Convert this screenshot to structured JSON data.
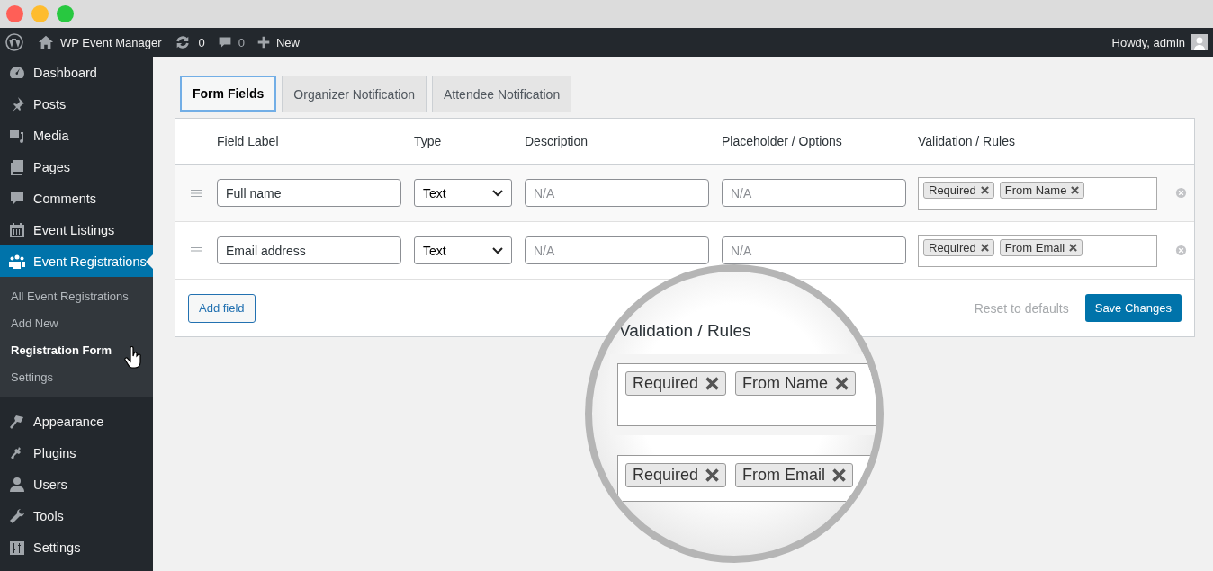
{
  "window": {
    "controls": [
      {
        "color": "#ff5f57"
      },
      {
        "color": "#febc2e"
      },
      {
        "color": "#28c840"
      }
    ]
  },
  "admin_bar": {
    "site_name": "WP Event Manager",
    "updates_count": "0",
    "comments_count": "0",
    "new_label": "New",
    "greeting": "Howdy, admin"
  },
  "sidebar": {
    "items": [
      {
        "label": "Dashboard",
        "selected": false
      },
      {
        "label": "Posts",
        "selected": false
      },
      {
        "label": "Media",
        "selected": false
      },
      {
        "label": "Pages",
        "selected": false
      },
      {
        "label": "Comments",
        "selected": false
      },
      {
        "label": "Event Listings",
        "selected": false
      },
      {
        "label": "Event Registrations",
        "selected": true,
        "children": [
          {
            "label": "All Event Registrations",
            "selected": false
          },
          {
            "label": "Add New",
            "selected": false
          },
          {
            "label": "Registration Form",
            "selected": true
          },
          {
            "label": "Settings",
            "selected": false
          }
        ]
      },
      {
        "label": "Appearance",
        "selected": false
      },
      {
        "label": "Plugins",
        "selected": false
      },
      {
        "label": "Users",
        "selected": false
      },
      {
        "label": "Tools",
        "selected": false
      },
      {
        "label": "Settings",
        "selected": false
      }
    ]
  },
  "tabs": [
    {
      "label": "Form Fields",
      "selected": true
    },
    {
      "label": "Organizer Notification",
      "selected": false
    },
    {
      "label": "Attendee Notification",
      "selected": false
    }
  ],
  "table": {
    "columns": [
      "Field Label",
      "Type",
      "Description",
      "Placeholder / Options",
      "Validation / Rules"
    ],
    "rows": [
      {
        "label": "Full name",
        "type": "Text",
        "description_placeholder": "N/A",
        "options_placeholder": "N/A",
        "rules": [
          "Required",
          "From Name"
        ]
      },
      {
        "label": "Email address",
        "type": "Text",
        "description_placeholder": "N/A",
        "options_placeholder": "N/A",
        "rules": [
          "Required",
          "From Email"
        ]
      }
    ]
  },
  "footer": {
    "add_button": "Add field",
    "reset_link": "Reset to defaults",
    "save_button": "Save Changes"
  },
  "magnifier": {
    "heading": "Validation / Rules",
    "rows": [
      {
        "rules": [
          "Required",
          "From Name"
        ]
      },
      {
        "rules": [
          "Required",
          "From Email"
        ]
      }
    ]
  }
}
